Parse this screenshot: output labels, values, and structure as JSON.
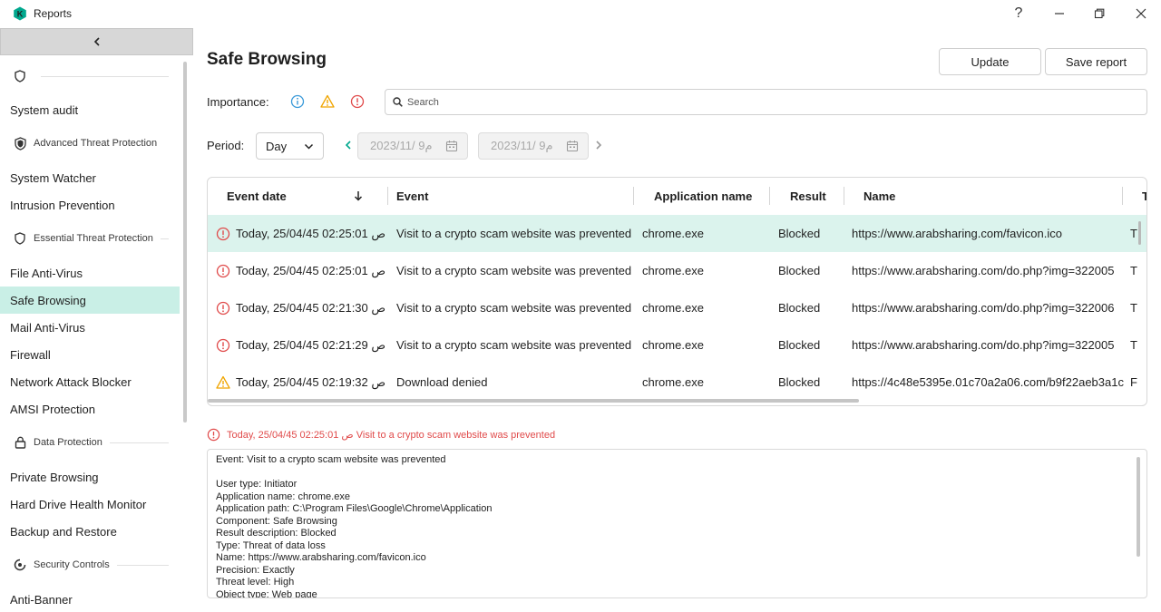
{
  "window": {
    "title": "Reports",
    "help_label": "?"
  },
  "sidebar": {
    "items": [
      {
        "label": "System audit",
        "active": false
      },
      {
        "label": "System Watcher",
        "active": false
      },
      {
        "label": "Intrusion Prevention",
        "active": false
      },
      {
        "label": "File Anti-Virus",
        "active": false
      },
      {
        "label": "Safe Browsing",
        "active": true
      },
      {
        "label": "Mail Anti-Virus",
        "active": false
      },
      {
        "label": "Firewall",
        "active": false
      },
      {
        "label": "Network Attack Blocker",
        "active": false
      },
      {
        "label": "AMSI Protection",
        "active": false
      },
      {
        "label": "Private Browsing",
        "active": false
      },
      {
        "label": "Hard Drive Health Monitor",
        "active": false
      },
      {
        "label": "Backup and Restore",
        "active": false
      },
      {
        "label": "Anti-Banner",
        "active": false
      }
    ],
    "sections": [
      {
        "label": ""
      },
      {
        "label": "Advanced Threat Protection"
      },
      {
        "label": "Essential Threat Protection"
      },
      {
        "label": "Data Protection"
      },
      {
        "label": "Security Controls"
      }
    ]
  },
  "header": {
    "title": "Safe Browsing",
    "update_label": "Update",
    "save_report_label": "Save report"
  },
  "filters": {
    "importance_label": "Importance:",
    "search_placeholder": "Search",
    "period_label": "Period:",
    "period_value": "Day",
    "date_from": "2023/11/ 9م",
    "date_to": "2023/11/ 9م"
  },
  "table": {
    "columns": [
      "Event date",
      "Event",
      "Application name",
      "Result",
      "Name",
      "T"
    ],
    "rows": [
      {
        "severity": "critical",
        "date": "Today, 25/04/45 02:25:01 ص",
        "event": "Visit to a crypto scam website was prevented",
        "app": "chrome.exe",
        "result": "Blocked",
        "name": "https://www.arabsharing.com/favicon.ico",
        "extra": "T",
        "selected": true
      },
      {
        "severity": "critical",
        "date": "Today, 25/04/45 02:25:01 ص",
        "event": "Visit to a crypto scam website was prevented",
        "app": "chrome.exe",
        "result": "Blocked",
        "name": "https://www.arabsharing.com/do.php?img=322005",
        "extra": "T",
        "selected": false
      },
      {
        "severity": "critical",
        "date": "Today, 25/04/45 02:21:30 ص",
        "event": "Visit to a crypto scam website was prevented",
        "app": "chrome.exe",
        "result": "Blocked",
        "name": "https://www.arabsharing.com/do.php?img=322006",
        "extra": "T",
        "selected": false
      },
      {
        "severity": "critical",
        "date": "Today, 25/04/45 02:21:29 ص",
        "event": "Visit to a crypto scam website was prevented",
        "app": "chrome.exe",
        "result": "Blocked",
        "name": "https://www.arabsharing.com/do.php?img=322005",
        "extra": "T",
        "selected": false
      },
      {
        "severity": "warning",
        "date": "Today, 25/04/45 02:19:32 ص",
        "event": "Download denied",
        "app": "chrome.exe",
        "result": "Blocked",
        "name": "https://4c48e5395e.01c70a2a06.com/b9f22aeb3a1c",
        "extra": "F",
        "selected": false
      }
    ]
  },
  "detail": {
    "heading": "Today, 25/04/45 02:25:01 ص Visit to a crypto scam website was prevented",
    "lines": [
      "Event: Visit to a crypto scam website was prevented",
      "",
      "User type: Initiator",
      "Application name: chrome.exe",
      "Application path: C:\\Program Files\\Google\\Chrome\\Application",
      "Component: Safe Browsing",
      "Result description: Blocked",
      "Type: Threat of data loss",
      "Name: https://www.arabsharing.com/favicon.ico",
      "Precision: Exactly",
      "Threat level: High",
      "Object type: Web page"
    ]
  },
  "colors": {
    "accent": "#00a88e",
    "selected_row": "#dbf3ed",
    "active_nav": "#c9efe6",
    "critical": "#e04a4a",
    "warning": "#f0a500",
    "info": "#3a9ad9"
  }
}
